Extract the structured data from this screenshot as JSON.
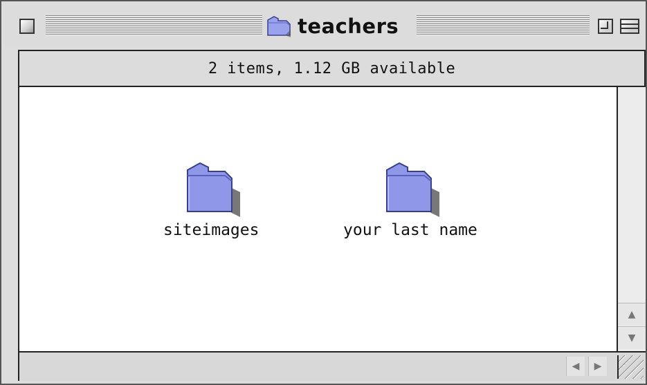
{
  "window": {
    "title": "teachers",
    "title_icon": "folder-icon"
  },
  "info": {
    "status": "2 items, 1.12 GB available"
  },
  "items": [
    {
      "label": "siteimages",
      "icon": "folder-icon"
    },
    {
      "label": "your last name",
      "icon": "folder-icon"
    }
  ],
  "colors": {
    "folder_fill": "#8f98e8",
    "folder_dark": "#4a52a8",
    "window_bg": "#dcdcdc",
    "content_bg": "#ffffff"
  }
}
